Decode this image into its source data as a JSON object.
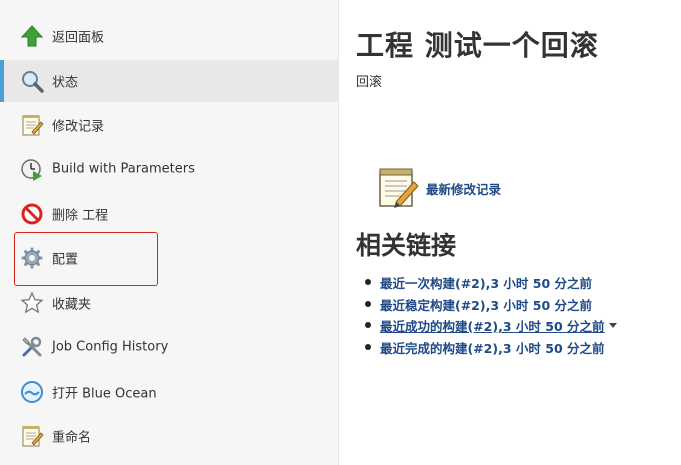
{
  "sidebar": {
    "items": [
      {
        "label": "返回面板",
        "icon": "up-arrow-icon"
      },
      {
        "label": "状态",
        "icon": "magnifier-icon"
      },
      {
        "label": "修改记录",
        "icon": "notepad-icon"
      },
      {
        "label": "Build with Parameters",
        "icon": "clock-play-icon"
      },
      {
        "label": "删除 工程",
        "icon": "no-entry-icon"
      },
      {
        "label": "配置",
        "icon": "gear-icon"
      },
      {
        "label": "收藏夹",
        "icon": "star-icon"
      },
      {
        "label": "Job Config History",
        "icon": "tools-icon"
      },
      {
        "label": "打开 Blue Ocean",
        "icon": "blue-ocean-icon"
      },
      {
        "label": "重命名",
        "icon": "notepad-icon"
      }
    ],
    "active_item": "状态",
    "highlighted_item": "配置",
    "colors": {
      "active_bar": "#4b9fd5",
      "highlight_border": "#d9261c"
    }
  },
  "main": {
    "title": "工程 测试一个回滚",
    "description": "回滚",
    "recent_changes_link": "最新修改记录",
    "related_links_heading": "相关链接",
    "related_links": [
      "最近一次构建(#2),3 小时 50 分之前",
      "最近稳定构建(#2),3 小时 50 分之前",
      "最近成功的构建(#2),3 小时 50 分之前",
      "最近完成的构建(#2),3 小时 50 分之前"
    ],
    "link_color": "#204a87"
  }
}
